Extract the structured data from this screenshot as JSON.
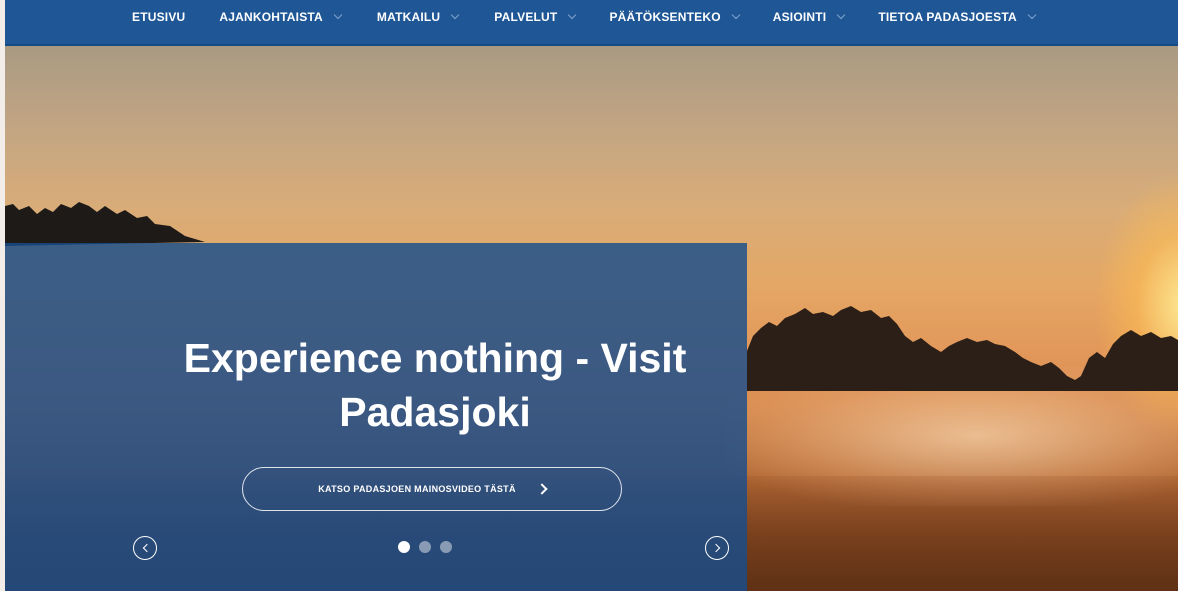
{
  "nav": {
    "items": [
      {
        "label": "ETUSIVU",
        "has_dropdown": false
      },
      {
        "label": "AJANKOHTAISTA",
        "has_dropdown": true
      },
      {
        "label": "MATKAILU",
        "has_dropdown": true
      },
      {
        "label": "PALVELUT",
        "has_dropdown": true
      },
      {
        "label": "PÄÄTÖKSENTEKO",
        "has_dropdown": true
      },
      {
        "label": "ASIOINTI",
        "has_dropdown": true
      },
      {
        "label": "TIETOA PADASJOESTA",
        "has_dropdown": true
      }
    ]
  },
  "hero": {
    "title_line1": "Experience nothing - Visit",
    "title_line2": "Padasjoki",
    "cta_label": "KATSO PADASJOEN MAINOSVIDEO TÄSTÄ",
    "slides_total": 3,
    "active_slide": 1,
    "prev_icon": "chevron-left-circle-icon",
    "next_icon": "chevron-right-circle-icon"
  },
  "colors": {
    "nav_bg": "#1f5796",
    "panel_bg": "#174d8c"
  }
}
